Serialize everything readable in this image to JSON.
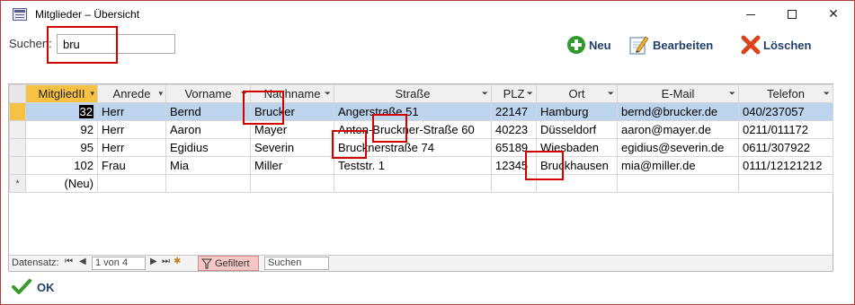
{
  "window": {
    "title": "Mitglieder – Übersicht",
    "controls": {
      "minimize": "",
      "maximize": "",
      "close": "✕"
    }
  },
  "search": {
    "label": "Suchen:",
    "value": "bru"
  },
  "toolbar": {
    "new_label": "Neu",
    "edit_label": "Bearbeiten",
    "delete_label": "Löschen"
  },
  "grid": {
    "columns": [
      "MitgliedII",
      "Anrede",
      "Vorname",
      "Nachname",
      "Straße",
      "PLZ",
      "Ort",
      "E-Mail",
      "Telefon"
    ],
    "rows": [
      {
        "id": "32",
        "anrede": "Herr",
        "vorname": "Bernd",
        "nachname": "Brucker",
        "strasse": "Angerstraße 51",
        "plz": "22147",
        "ort": "Hamburg",
        "email": "bernd@brucker.de",
        "telefon": "040/237057"
      },
      {
        "id": "92",
        "anrede": "Herr",
        "vorname": "Aaron",
        "nachname": "Mayer",
        "strasse": "Anton-Bruckner-Straße 60",
        "plz": "40223",
        "ort": "Düsseldorf",
        "email": "aaron@mayer.de",
        "telefon": "0211/011172"
      },
      {
        "id": "95",
        "anrede": "Herr",
        "vorname": "Egidius",
        "nachname": "Severin",
        "strasse": "Brucknerstraße 74",
        "plz": "65189",
        "ort": "Wiesbaden",
        "email": "egidius@severin.de",
        "telefon": "0611/307922"
      },
      {
        "id": "102",
        "anrede": "Frau",
        "vorname": "Mia",
        "nachname": "Miller",
        "strasse": "Teststr. 1",
        "plz": "12345",
        "ort": "Bruckhausen",
        "email": "mia@miller.de",
        "telefon": "0111/12121212"
      }
    ],
    "new_row_label": "(Neu)",
    "new_row_marker": "*"
  },
  "navigation": {
    "label": "Datensatz:",
    "position": "1 von 4",
    "filter_label": "Gefiltert",
    "search_label": "Suchen"
  },
  "footer": {
    "ok_label": "OK"
  },
  "colors": {
    "highlight_box": "#d40000",
    "selected_row": "#bcd4ee",
    "selected_header": "#f7c244",
    "button_text": "#1f3e6b"
  }
}
